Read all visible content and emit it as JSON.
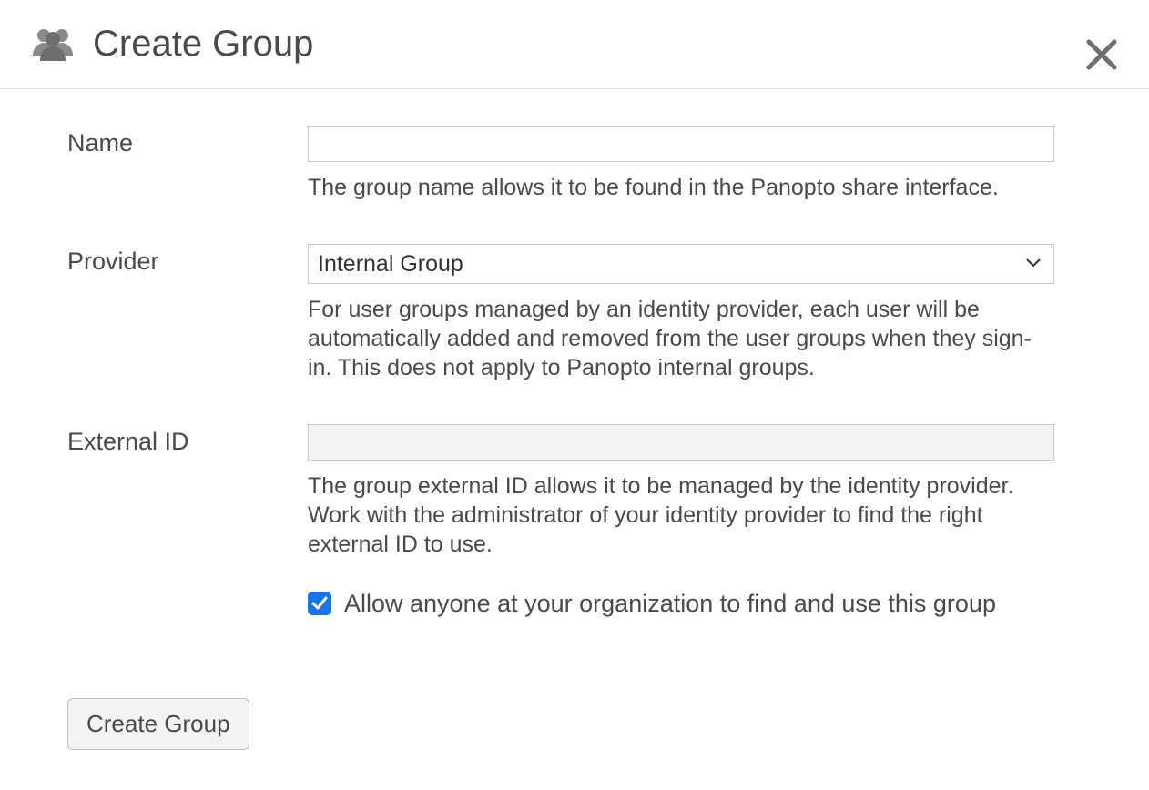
{
  "dialog": {
    "title": "Create Group"
  },
  "form": {
    "name": {
      "label": "Name",
      "value": "",
      "help": "The group name allows it to be found in the Panopto share interface."
    },
    "provider": {
      "label": "Provider",
      "selected": "Internal Group",
      "help": "For user groups managed by an identity provider, each user will be automatically added and removed from the user groups when they sign-in. This does not apply to Panopto internal groups."
    },
    "external_id": {
      "label": "External ID",
      "value": "",
      "help": "The group external ID allows it to be managed by the identity provider. Work with the administrator of your identity provider to find the right external ID to use."
    },
    "allow_find": {
      "checked": true,
      "label": "Allow anyone at your organization to find and use this group"
    },
    "submit_label": "Create Group"
  }
}
